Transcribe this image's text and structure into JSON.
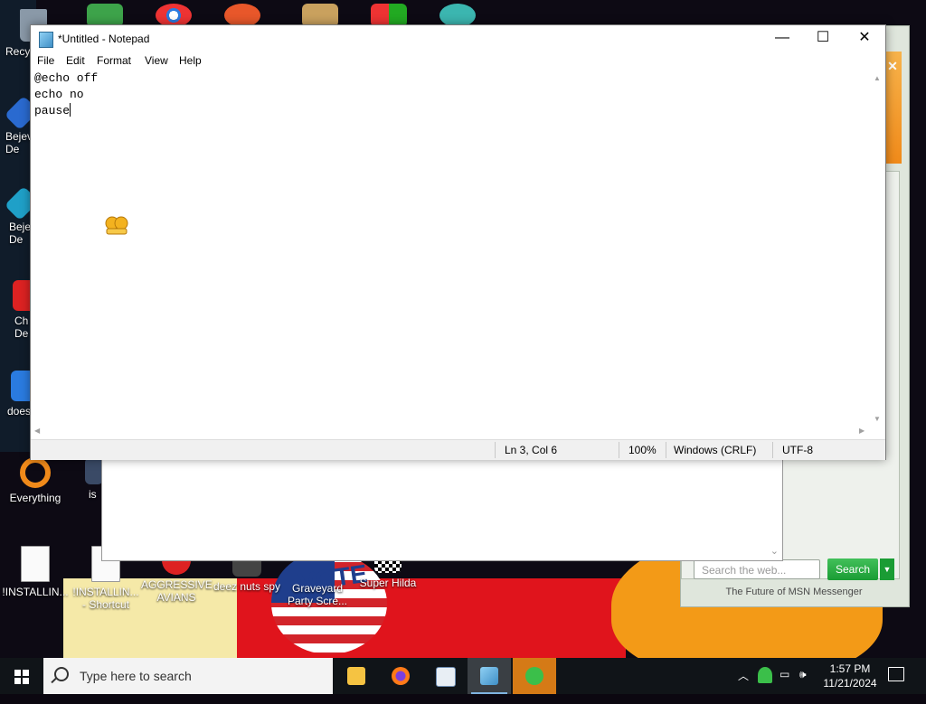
{
  "notepad": {
    "title": "*Untitled - Notepad",
    "menu": [
      "File",
      "Edit",
      "Format",
      "View",
      "Help"
    ],
    "lines": [
      "@echo off",
      "echo no",
      "pause"
    ],
    "status": {
      "position": "Ln 3, Col 6",
      "zoom": "100%",
      "line_endings": "Windows (CRLF)",
      "encoding": "UTF-8"
    },
    "buttons": {
      "minimize": "—",
      "maximize": "☐",
      "close": "✕"
    }
  },
  "msn": {
    "search_placeholder": "Search the web...",
    "search_button": "Search",
    "footer": "The Future of MSN Messenger",
    "close": "✕"
  },
  "desktop_icons": {
    "recycle": "Recy",
    "bejeweled1": "Bejev\nDe",
    "bejeweled2": "Beje\nDe",
    "chrome_de": "Ch\nDe",
    "does": "does",
    "everything": "Everything",
    "is": "is",
    "installing1": "!INSTALLIN...",
    "installing2": "!INSTALLIN...\n- Shortcut",
    "aggressive": "AGGRESSIVE\nAVIANS",
    "deez": "deez nuts spy",
    "graveyard": "Graveyard\nParty Scre...",
    "hilda": "Super Hilda",
    "vote": "VOTE"
  },
  "taskbar": {
    "search_placeholder": "Type here to search",
    "time": "1:57 PM",
    "date": "11/21/2024",
    "apps": [
      "file-explorer",
      "firefox",
      "app",
      "notepad",
      "msn-messenger"
    ]
  }
}
